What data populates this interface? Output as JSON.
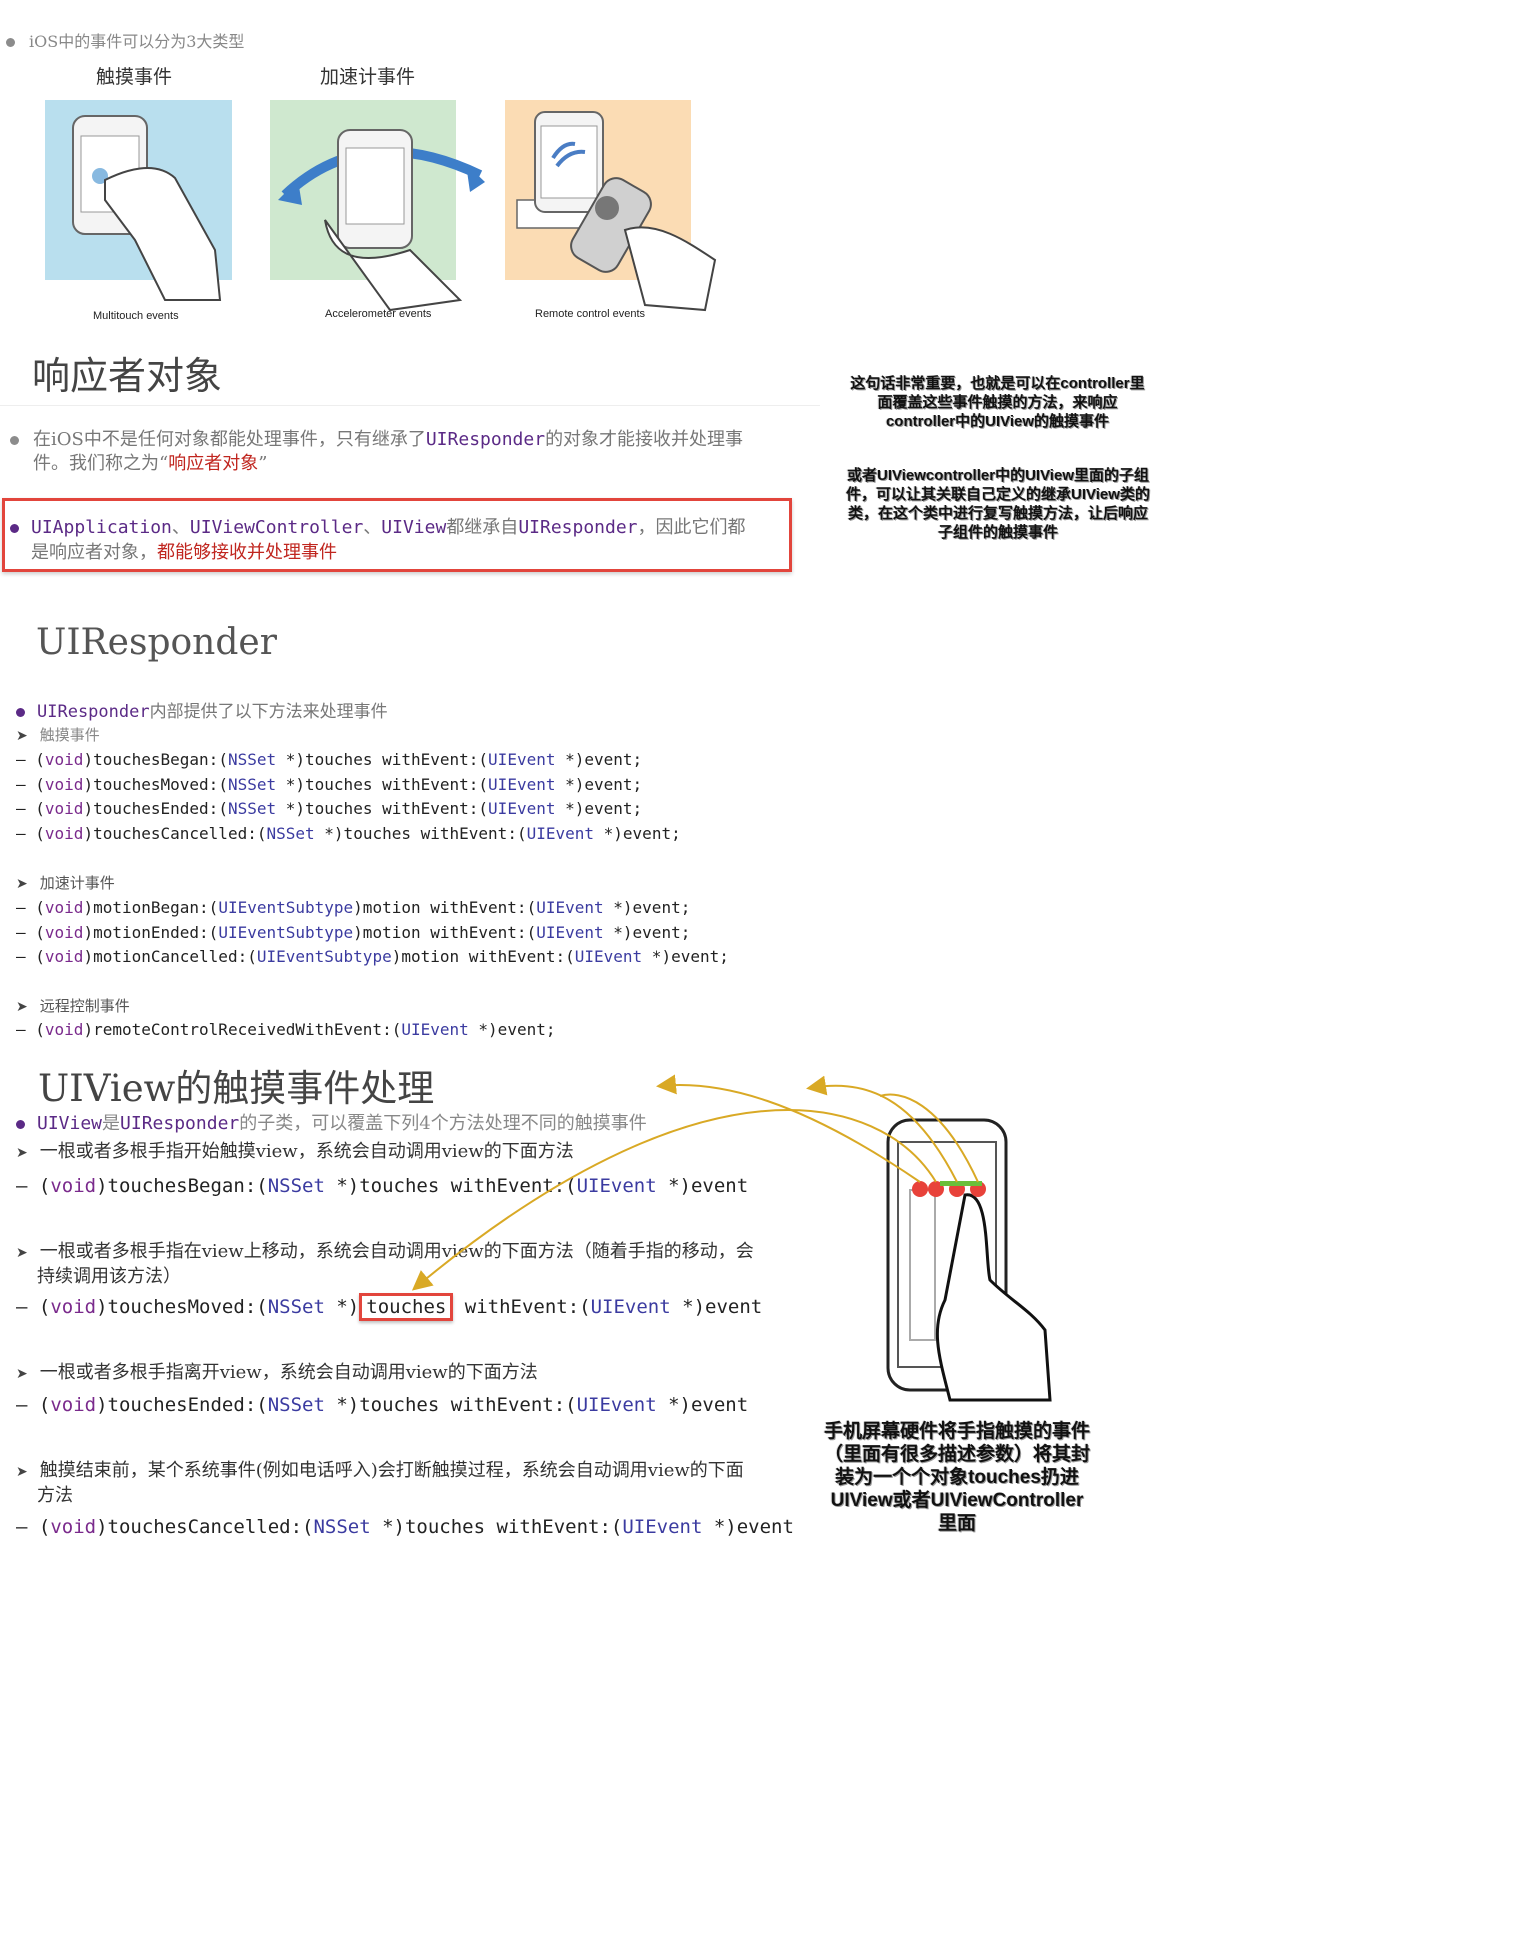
{
  "intro": {
    "text": "iOS中的事件可以分为3大类型"
  },
  "event_types": [
    {
      "label": "触摸事件",
      "caption": "Multitouch events",
      "color": "#b9dfee"
    },
    {
      "label": "加速计事件",
      "caption": "Accelerometer events",
      "color": "#cfe8cf"
    },
    {
      "label": "",
      "caption": "Remote control events",
      "color": "#fbdcb4"
    }
  ],
  "responder": {
    "title": "响应者对象",
    "p1_pre": "在iOS中不是任何对象都能处理事件，只有继承了",
    "p1_class": "UIResponder",
    "p1_mid": "的对象才能接收并处理事",
    "p1_line2": "件。我们称之为“",
    "p1_red": "响应者对象",
    "p1_end": "”",
    "p2_a": "UIApplication",
    "p2_sep1": "、",
    "p2_b": "UIViewController",
    "p2_sep2": "、",
    "p2_c": "UIView",
    "p2_mid": "都继承自",
    "p2_d": "UIResponder",
    "p2_tail": "，因此它们都",
    "p2_line2": "是响应者对象，",
    "p2_red": "都能够接收并处理事件"
  },
  "uiresponder": {
    "title": "UIResponder",
    "intro_class": "UIResponder",
    "intro_text": "内部提供了以下方法来处理事件",
    "touch_heading": "触摸事件",
    "touch_methods": [
      {
        "name": "touchesBegan:",
        "arg": "NSSet",
        "rest": " *)touches withEvent:(",
        "ev": "UIEvent",
        "end": " *)event;"
      },
      {
        "name": "touchesMoved:",
        "arg": "NSSet",
        "rest": " *)touches withEvent:(",
        "ev": "UIEvent",
        "end": " *)event;"
      },
      {
        "name": "touchesEnded:",
        "arg": "NSSet",
        "rest": " *)touches withEvent:(",
        "ev": "UIEvent",
        "end": " *)event;"
      },
      {
        "name": "touchesCancelled:",
        "arg": "NSSet",
        "rest": " *)touches withEvent:(",
        "ev": "UIEvent",
        "end": " *)event;"
      }
    ],
    "accel_heading": "加速计事件",
    "accel_methods": [
      {
        "name": "motionBegan:",
        "arg": "UIEventSubtype",
        "rest": ")motion withEvent:(",
        "ev": "UIEvent",
        "end": " *)event;"
      },
      {
        "name": "motionEnded:",
        "arg": "UIEventSubtype",
        "rest": ")motion withEvent:(",
        "ev": "UIEvent",
        "end": " *)event;"
      },
      {
        "name": "motionCancelled:",
        "arg": "UIEventSubtype",
        "rest": ")motion withEvent:(",
        "ev": "UIEvent",
        "end": " *)event;"
      }
    ],
    "remote_heading": "远程控制事件",
    "remote_method": {
      "name": "remoteControlReceivedWithEvent:",
      "ev": "UIEvent",
      "end": " *)event;"
    }
  },
  "uiview": {
    "title": "UIView的触摸事件处理",
    "intro_a": "UIView",
    "intro_b": "是",
    "intro_c": "UIResponder",
    "intro_d": "的子类，可以覆盖下列4个方法处理不同的触摸事件",
    "items": [
      {
        "desc": "一根或者多根手指开始触摸view，系统会自动调用view的下面方法",
        "desc2": "",
        "method": "touchesBegan:"
      },
      {
        "desc": "一根或者多根手指在view上移动，系统会自动调用view的下面方法（随着手指的移动，会",
        "desc2": "持续调用该方法）",
        "method": "touchesMoved:"
      },
      {
        "desc": "一根或者多根手指离开view，系统会自动调用view的下面方法",
        "desc2": "",
        "method": "touchesEnded:"
      },
      {
        "desc": "触摸结束前，某个系统事件(例如电话呼入)会打断触摸过程，系统会自动调用view的下面",
        "desc2": "方法",
        "method": "touchesCancelled:"
      }
    ],
    "void": "void",
    "nsset": "NSSet",
    "touches_text": " *)touches",
    "with_event": " withEvent:(",
    "uievent": "UIEvent",
    "event_tail": " *)event",
    "touches_boxed": "touches"
  },
  "notes": {
    "note1": "这句话非常重要，也就是可以在controller里面覆盖这些事件触摸的方法，来响应controller中的UIView的触摸事件",
    "note2": "或者UIViewcontroller中的UIView里面的子组件，可以让其关联自己定义的继承UIView类的类，在这个类中进行复写触摸方法，让后响应子组件的触摸事件",
    "note3": "手机屏幕硬件将手指触摸的事件（里面有很多描述参数）将其封装为一个个对象touches扔进UIView或者UIViewController里面"
  },
  "colors": {
    "purple": "#5b2a86",
    "red_box": "#e2453c",
    "arrow": "#d9a925",
    "touch_dot": "#e8423a"
  }
}
